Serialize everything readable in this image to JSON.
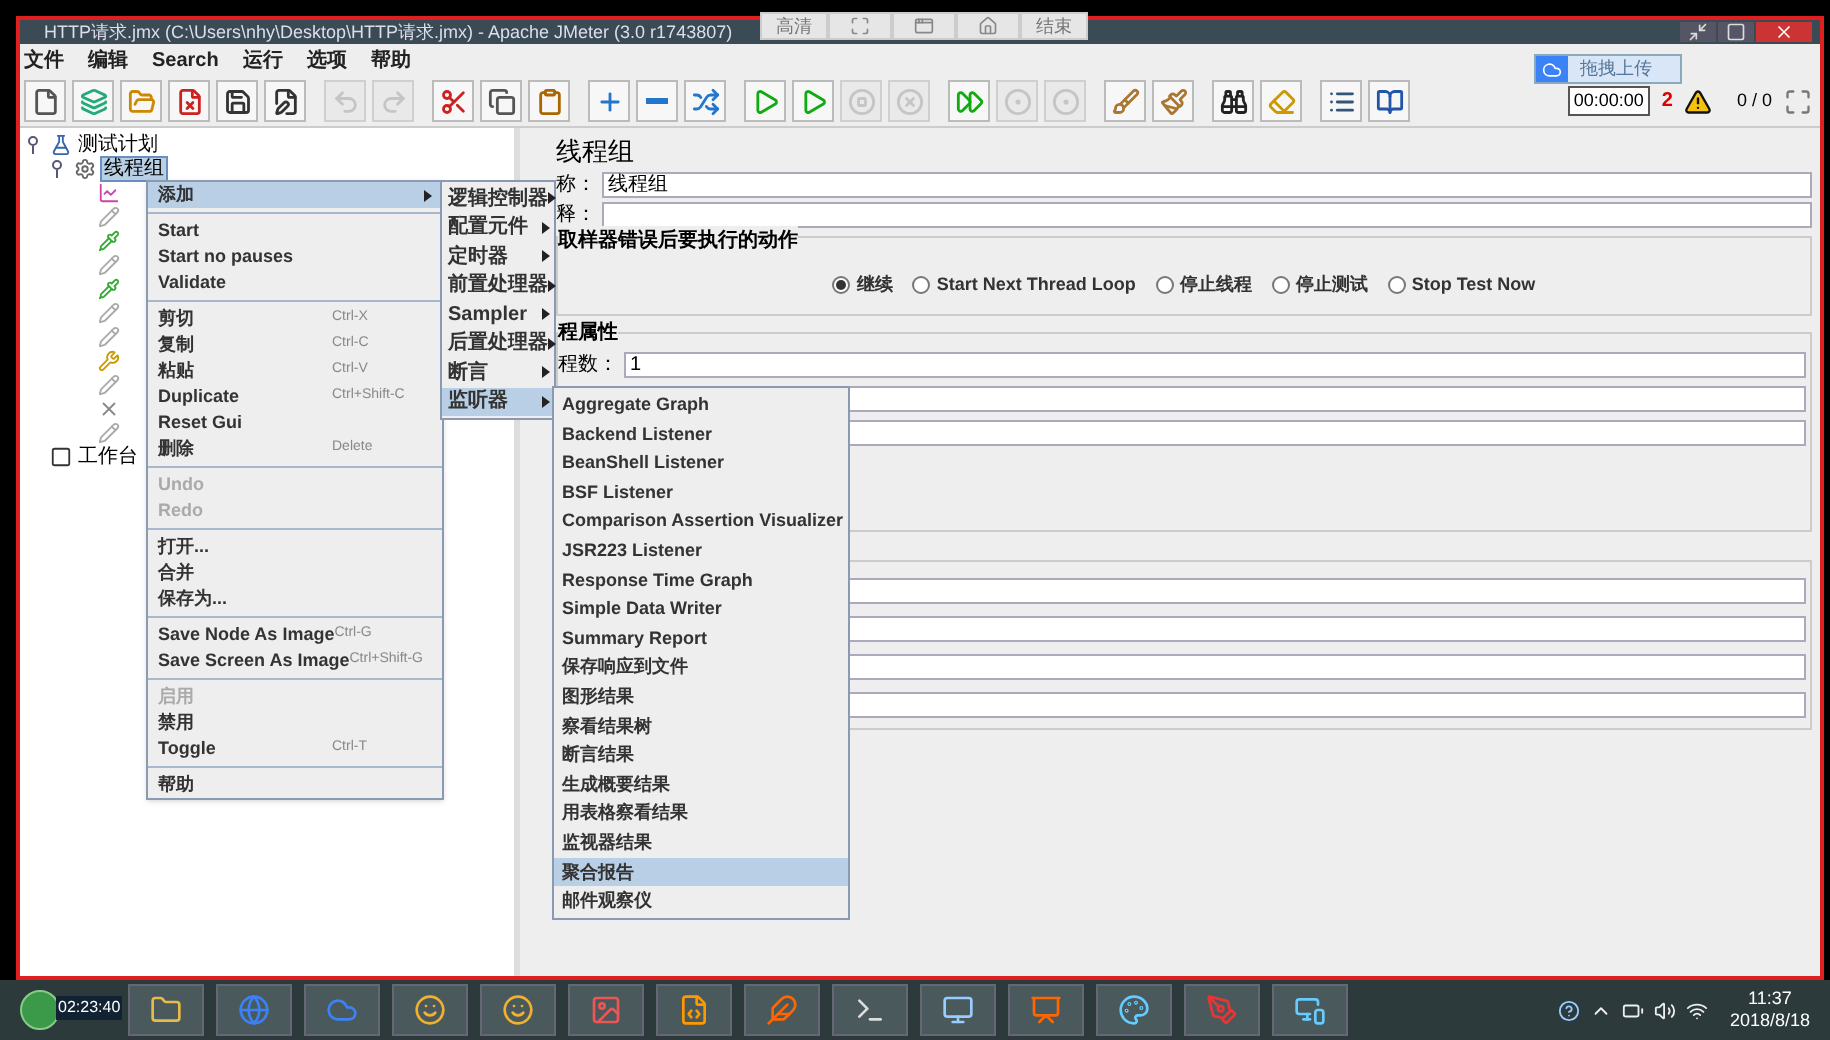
{
  "window": {
    "title": "HTTP请求.jmx (C:\\Users\\nhy\\Desktop\\HTTP请求.jmx) - Apache JMeter (3.0 r1743807)"
  },
  "recorder_bar": [
    {
      "kind": "text",
      "label": "高清"
    },
    {
      "kind": "fullscreen"
    },
    {
      "kind": "window"
    },
    {
      "kind": "home"
    },
    {
      "kind": "text",
      "label": "结束"
    }
  ],
  "menu_bar": [
    "文件",
    "编辑",
    "Search",
    "运行",
    "选项",
    "帮助"
  ],
  "toolbar": [
    {
      "kind": "new",
      "disabled": false
    },
    {
      "kind": "templates",
      "disabled": false
    },
    {
      "kind": "open",
      "disabled": false
    },
    {
      "kind": "close",
      "disabled": false
    },
    {
      "kind": "save",
      "disabled": false
    },
    {
      "kind": "save-as",
      "disabled": false
    },
    {
      "kind": "sep"
    },
    {
      "kind": "undo",
      "disabled": true
    },
    {
      "kind": "redo",
      "disabled": true
    },
    {
      "kind": "sep"
    },
    {
      "kind": "cut",
      "disabled": false
    },
    {
      "kind": "copy",
      "disabled": false
    },
    {
      "kind": "paste",
      "disabled": false
    },
    {
      "kind": "sep"
    },
    {
      "kind": "expand",
      "disabled": false
    },
    {
      "kind": "collapse",
      "disabled": false
    },
    {
      "kind": "toggle",
      "disabled": false
    },
    {
      "kind": "sep"
    },
    {
      "kind": "start",
      "disabled": false
    },
    {
      "kind": "start-no-pauses",
      "disabled": false
    },
    {
      "kind": "stop",
      "disabled": true
    },
    {
      "kind": "shutdown",
      "disabled": true
    },
    {
      "kind": "sep"
    },
    {
      "kind": "remote-start",
      "disabled": false
    },
    {
      "kind": "remote-stop",
      "disabled": true
    },
    {
      "kind": "remote-exit",
      "disabled": true
    },
    {
      "kind": "sep"
    },
    {
      "kind": "clear",
      "disabled": false
    },
    {
      "kind": "clear-all",
      "disabled": false
    },
    {
      "kind": "sep"
    },
    {
      "kind": "search",
      "disabled": false
    },
    {
      "kind": "reset",
      "disabled": false
    },
    {
      "kind": "sep"
    },
    {
      "kind": "function",
      "disabled": false
    },
    {
      "kind": "help",
      "disabled": false
    }
  ],
  "upload_button": "拖拽上传",
  "status": {
    "timer": "00:00:00",
    "errors": "2",
    "threads": "0 / 0"
  },
  "tree": [
    {
      "label": "测试计划",
      "kind": "plan",
      "selected": false,
      "children": [
        {
          "label": "线程组",
          "kind": "thread-group",
          "selected": true,
          "children": [
            {
              "kind": "chart"
            },
            {
              "kind": "pencil"
            },
            {
              "kind": "dropper"
            },
            {
              "kind": "pencil"
            },
            {
              "kind": "dropper"
            },
            {
              "kind": "pencil"
            },
            {
              "kind": "pencil"
            },
            {
              "kind": "tool"
            },
            {
              "kind": "pencil"
            },
            {
              "kind": "cross"
            },
            {
              "kind": "pencil"
            }
          ]
        }
      ]
    },
    {
      "label": "工作台",
      "kind": "workbench",
      "selected": false
    }
  ],
  "context_menu": [
    {
      "kind": "item",
      "label": "添加",
      "submenu": true,
      "selected": true,
      "disabled": false
    },
    {
      "kind": "sep"
    },
    {
      "kind": "item",
      "label": "Start",
      "selected": false,
      "disabled": false
    },
    {
      "kind": "item",
      "label": "Start no pauses",
      "selected": false,
      "disabled": false
    },
    {
      "kind": "item",
      "label": "Validate",
      "selected": false,
      "disabled": false
    },
    {
      "kind": "sep"
    },
    {
      "kind": "item",
      "label": "剪切",
      "shortcut": "Ctrl-X",
      "selected": false,
      "disabled": false
    },
    {
      "kind": "item",
      "label": "复制",
      "shortcut": "Ctrl-C",
      "selected": false,
      "disabled": false
    },
    {
      "kind": "item",
      "label": "粘贴",
      "shortcut": "Ctrl-V",
      "selected": false,
      "disabled": false
    },
    {
      "kind": "item",
      "label": "Duplicate",
      "shortcut": "Ctrl+Shift-C",
      "selected": false,
      "disabled": false
    },
    {
      "kind": "item",
      "label": "Reset Gui",
      "selected": false,
      "disabled": false
    },
    {
      "kind": "item",
      "label": "删除",
      "shortcut": "Delete",
      "selected": false,
      "disabled": false
    },
    {
      "kind": "sep"
    },
    {
      "kind": "item",
      "label": "Undo",
      "selected": false,
      "disabled": true
    },
    {
      "kind": "item",
      "label": "Redo",
      "selected": false,
      "disabled": true
    },
    {
      "kind": "sep"
    },
    {
      "kind": "item",
      "label": "打开...",
      "selected": false,
      "disabled": false
    },
    {
      "kind": "item",
      "label": "合并",
      "selected": false,
      "disabled": false
    },
    {
      "kind": "item",
      "label": "保存为...",
      "selected": false,
      "disabled": false
    },
    {
      "kind": "sep"
    },
    {
      "kind": "item",
      "label": "Save Node As Image",
      "shortcut": "Ctrl-G",
      "selected": false,
      "disabled": false
    },
    {
      "kind": "item",
      "label": "Save Screen As Image",
      "shortcut": "Ctrl+Shift-G",
      "selected": false,
      "disabled": false
    },
    {
      "kind": "sep"
    },
    {
      "kind": "item",
      "label": "启用",
      "selected": false,
      "disabled": true
    },
    {
      "kind": "item",
      "label": "禁用",
      "selected": false,
      "disabled": false
    },
    {
      "kind": "item",
      "label": "Toggle",
      "shortcut": "Ctrl-T",
      "selected": false,
      "disabled": false
    },
    {
      "kind": "sep"
    },
    {
      "kind": "item",
      "label": "帮助",
      "selected": false,
      "disabled": false
    }
  ],
  "add_submenu": [
    {
      "label": "逻辑控制器",
      "selected": false
    },
    {
      "label": "配置元件",
      "selected": false
    },
    {
      "label": "定时器",
      "selected": false
    },
    {
      "label": "前置处理器",
      "selected": false
    },
    {
      "label": "Sampler",
      "selected": false
    },
    {
      "label": "后置处理器",
      "selected": false
    },
    {
      "label": "断言",
      "selected": false
    },
    {
      "label": "监听器",
      "selected": true
    }
  ],
  "listener_submenu": [
    {
      "label": "Aggregate Graph",
      "selected": false
    },
    {
      "label": "Backend Listener",
      "selected": false
    },
    {
      "label": "BeanShell Listener",
      "selected": false
    },
    {
      "label": "BSF Listener",
      "selected": false
    },
    {
      "label": "Comparison Assertion Visualizer",
      "selected": false
    },
    {
      "label": "JSR223 Listener",
      "selected": false
    },
    {
      "label": "Response Time Graph",
      "selected": false
    },
    {
      "label": "Simple Data Writer",
      "selected": false
    },
    {
      "label": "Summary Report",
      "selected": false
    },
    {
      "label": "保存响应到文件",
      "selected": false
    },
    {
      "label": "图形结果",
      "selected": false
    },
    {
      "label": "察看结果树",
      "selected": false
    },
    {
      "label": "断言结果",
      "selected": false
    },
    {
      "label": "生成概要结果",
      "selected": false
    },
    {
      "label": "用表格察看结果",
      "selected": false
    },
    {
      "label": "监视器结果",
      "selected": false
    },
    {
      "label": "聚合报告",
      "selected": true
    },
    {
      "label": "邮件观察仪",
      "selected": false
    }
  ],
  "panel": {
    "title": "线程组",
    "name_label": "称：",
    "name_value": "线程组",
    "comment_label": "释：",
    "error_group": {
      "title": "取样器错误后要执行的动作",
      "options": [
        {
          "label": "继续",
          "selected": true
        },
        {
          "label": "Start Next Thread Loop",
          "selected": false
        },
        {
          "label": "停止线程",
          "selected": false
        },
        {
          "label": "停止测试",
          "selected": false
        },
        {
          "label": "Stop Test Now",
          "selected": false
        }
      ]
    },
    "thread_group": {
      "title": "程属性",
      "threads_label": "程数：",
      "threads_value": "1"
    }
  },
  "taskbar": {
    "timer": "02:23:40",
    "apps": [
      {
        "kind": "folder"
      },
      {
        "kind": "globe"
      },
      {
        "kind": "cloud"
      },
      {
        "kind": "smile"
      },
      {
        "kind": "smile"
      },
      {
        "kind": "image"
      },
      {
        "kind": "code"
      },
      {
        "kind": "feather"
      },
      {
        "kind": "terminal"
      },
      {
        "kind": "monitor"
      },
      {
        "kind": "slides"
      },
      {
        "kind": "palette"
      },
      {
        "kind": "pen"
      },
      {
        "kind": "screen"
      }
    ],
    "time": "11:37",
    "date": "2018/8/18"
  }
}
